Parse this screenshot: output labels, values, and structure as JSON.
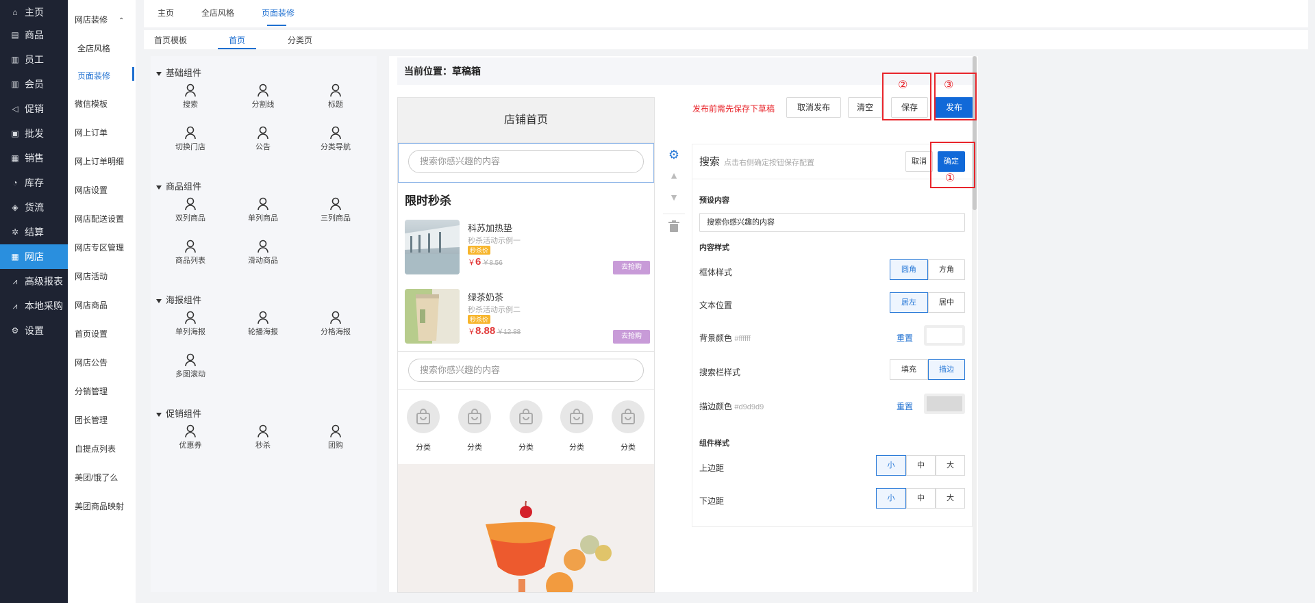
{
  "nav": [
    {
      "label": "主页",
      "icon": "home-icon"
    },
    {
      "label": "商品",
      "icon": "product-icon"
    },
    {
      "label": "员工",
      "icon": "staff-icon"
    },
    {
      "label": "会员",
      "icon": "member-icon"
    },
    {
      "label": "促销",
      "icon": "megaphone-icon"
    },
    {
      "label": "批发",
      "icon": "wholesale-icon"
    },
    {
      "label": "销售",
      "icon": "bar-chart-icon"
    },
    {
      "label": "库存",
      "icon": "pie-chart-icon"
    },
    {
      "label": "货流",
      "icon": "goods-flow-icon"
    },
    {
      "label": "结算",
      "icon": "settle-icon"
    },
    {
      "label": "网店",
      "icon": "shop-icon"
    },
    {
      "label": "高级报表",
      "icon": "line-chart-icon"
    },
    {
      "label": "本地采购",
      "icon": "trend-icon"
    },
    {
      "label": "设置",
      "icon": "gear-icon"
    }
  ],
  "nav_active": "网店",
  "sub": {
    "header": "网店装修",
    "items": [
      "全店风格",
      "页面装修",
      "微信模板",
      "网上订单",
      "网上订单明细",
      "网店设置",
      "网店配送设置",
      "网店专区管理",
      "网店活动",
      "网店商品",
      "首页设置",
      "网店公告",
      "分销管理",
      "团长管理",
      "自提点列表",
      "美团/饿了么",
      "美团商品映射"
    ]
  },
  "tabs": {
    "t0": "主页",
    "t1": "全店风格",
    "t2": "页面装修"
  },
  "subtabs": {
    "s0": "首页模板",
    "s1": "首页",
    "s2": "分类页"
  },
  "library": {
    "g0": {
      "title": "基础组件",
      "items": [
        "搜索",
        "分割线",
        "标题",
        "切换门店",
        "公告",
        "分类导航"
      ]
    },
    "g1": {
      "title": "商品组件",
      "items": [
        "双列商品",
        "单列商品",
        "三列商品",
        "商品列表",
        "滑动商品"
      ]
    },
    "g2": {
      "title": "海报组件",
      "items": [
        "单列海报",
        "轮播海报",
        "分格海报",
        "多图滚动"
      ]
    },
    "g3": {
      "title": "促销组件",
      "items": [
        "优惠券",
        "秒杀",
        "团购"
      ]
    }
  },
  "crumb": "当前位置：草稿箱",
  "actions": {
    "warn": "发布前需先保存下草稿",
    "cancel_publish": "取消发布",
    "clear": "清空",
    "save": "保存",
    "publish": "发布"
  },
  "phone": {
    "title": "店铺首页",
    "search_placeholder": "搜索你感兴趣的内容",
    "flash_title": "限时秒杀",
    "goods": [
      {
        "name": "科苏加热垫",
        "desc": "秒杀活动示例一",
        "tag": "秒杀价",
        "cur": "￥",
        "price": "6",
        "orig": "￥8.56",
        "btn": "去抢购"
      },
      {
        "name": "绿茶奶茶",
        "desc": "秒杀活动示例二",
        "tag": "秒杀价",
        "cur": "￥",
        "price": "8.88",
        "orig": "￥12.88",
        "btn": "去抢购"
      }
    ],
    "search2": "搜索你感兴趣的内容",
    "cats": [
      "分类",
      "分类",
      "分类",
      "分类",
      "分类"
    ]
  },
  "cfg": {
    "title": "搜索",
    "hint": "点击右侧确定按钮保存配置",
    "cancel": "取消",
    "ok": "确定",
    "preset_label": "预设内容",
    "preset_value": "搜索你感兴趣的内容",
    "style_label": "内容样式",
    "frame_label": "框体样式",
    "frame_opts": [
      "圆角",
      "方角"
    ],
    "text_pos_label": "文本位置",
    "text_pos_opts": [
      "居左",
      "居中"
    ],
    "bg_label": "背景颜色",
    "bg_value": "#ffffff",
    "reset": "重置",
    "bar_label": "搜索栏样式",
    "bar_opts": [
      "填充",
      "描边"
    ],
    "border_label": "描边颜色",
    "border_value": "#d9d9d9",
    "comp_style_label": "组件样式",
    "top_label": "上边距",
    "bottom_label": "下边距",
    "size_opts": [
      "小",
      "中",
      "大"
    ]
  },
  "marks": {
    "m1": "①",
    "m2": "②",
    "m3": "③"
  },
  "colors": {
    "nav_bg": "#1e2332",
    "nav_active": "#2a8fde",
    "primary": "#1169d8",
    "highlight": "#e8252b"
  }
}
